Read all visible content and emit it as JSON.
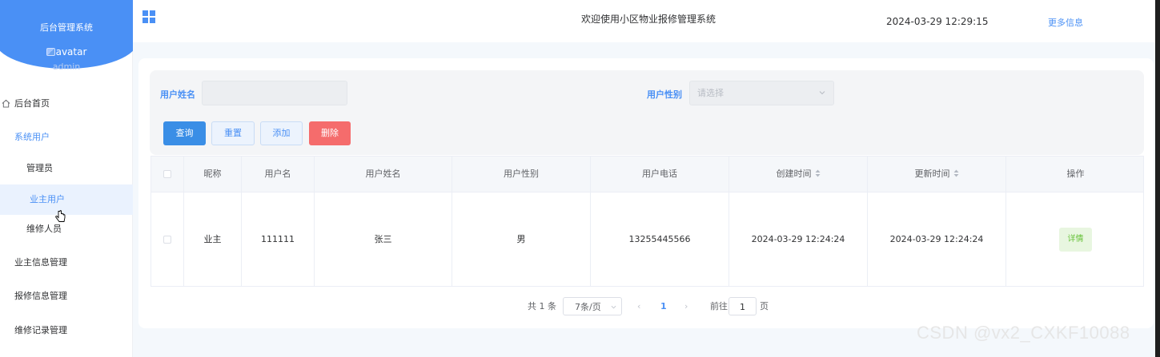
{
  "sidebar": {
    "brand": "后台管理系统",
    "avatar_alt": "avatar",
    "username": "admin",
    "home": "后台首页",
    "group": "系统用户",
    "sub_items": [
      "管理员",
      "业主用户",
      "维修人员"
    ],
    "menu_items": [
      "业主信息管理",
      "报修信息管理",
      "维修记录管理"
    ]
  },
  "header": {
    "title": "欢迎使用小区物业报修管理系统",
    "datetime": "2024-03-29 12:29:15",
    "more": "更多信息"
  },
  "search": {
    "name_label": "用户姓名",
    "name_value": "",
    "gender_label": "用户性别",
    "gender_placeholder": "请选择",
    "buttons": {
      "query": "查询",
      "reset": "重置",
      "add": "添加",
      "delete": "删除"
    }
  },
  "table": {
    "columns": [
      "昵称",
      "用户名",
      "用户姓名",
      "用户性别",
      "用户电话",
      "创建时间",
      "更新时间",
      "操作"
    ],
    "rows": [
      {
        "nickname": "业主",
        "username": "111111",
        "name": "张三",
        "gender": "男",
        "phone": "13255445566",
        "created": "2024-03-29 12:24:24",
        "updated": "2024-03-29 12:24:24",
        "action": "详情"
      }
    ]
  },
  "pagination": {
    "total": "共 1 条",
    "page_size": "7条/页",
    "current_page": "1",
    "goto_label": "前往",
    "goto_value": "1",
    "goto_unit": "页"
  },
  "watermark": "CSDN @vx2_CXKF10088",
  "colors": {
    "primary": "#4a90f5",
    "danger": "#f56c6c",
    "success": "#67c23a"
  }
}
